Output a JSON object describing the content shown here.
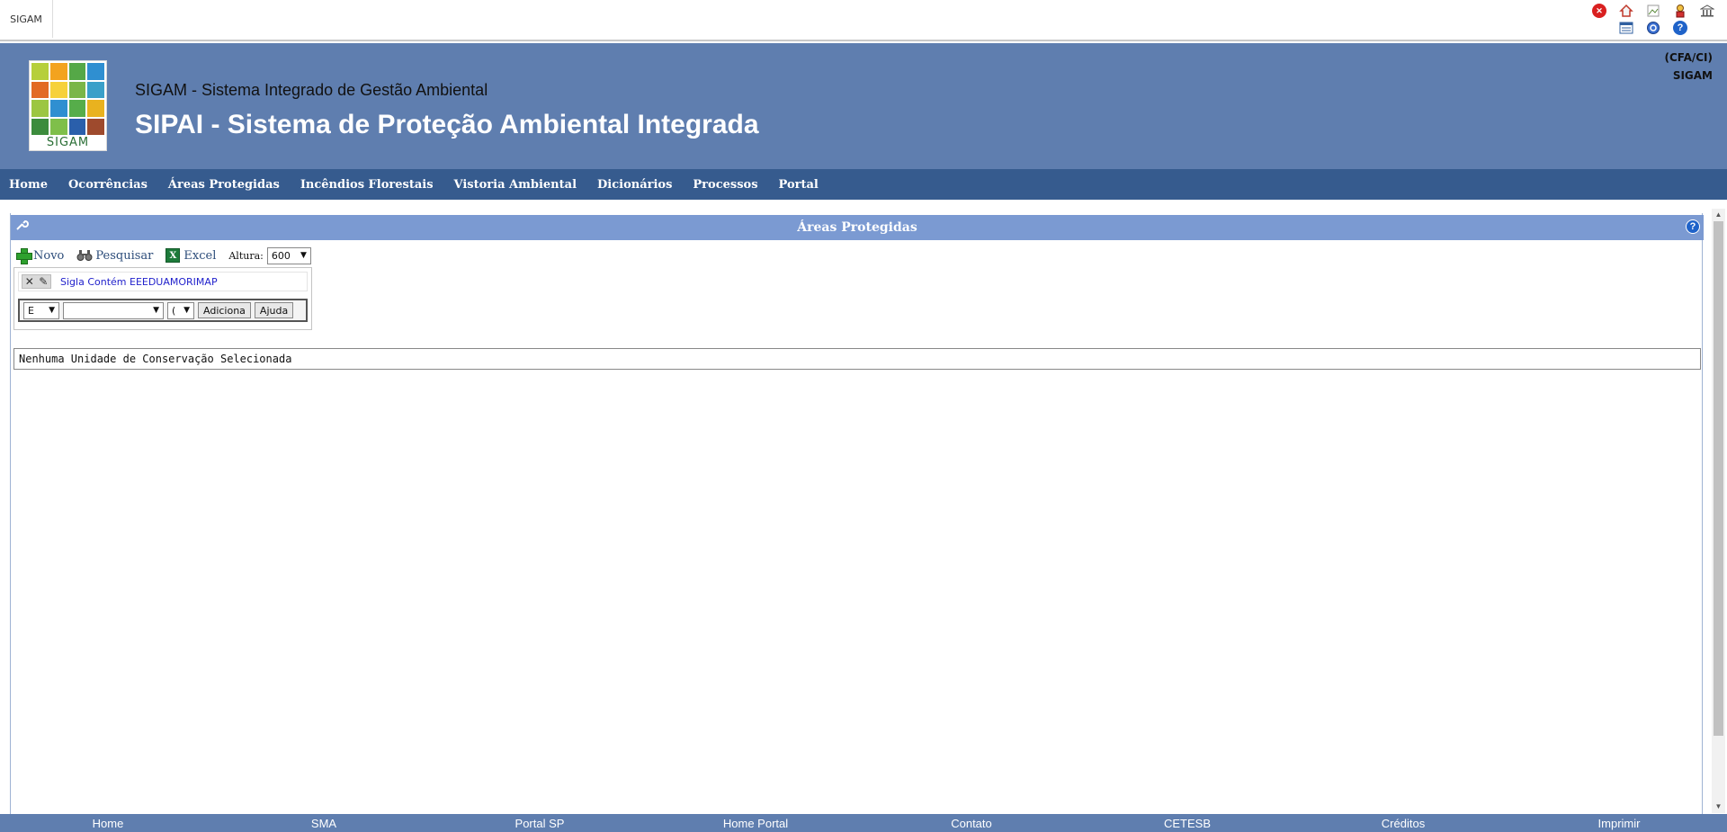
{
  "topbar": {
    "app_tab": "SIGAM",
    "icons": [
      "close-icon",
      "home-icon",
      "broken-image-icon",
      "user-icon",
      "institution-icon",
      "calendar-icon",
      "settings-icon",
      "help-icon"
    ],
    "help_glyph": "?",
    "close_glyph": "✕"
  },
  "header": {
    "logo_text": "SIGAM",
    "subtitle": "SIGAM - Sistema Integrado de Gestão Ambiental",
    "title": "SIPAI - Sistema de Proteção Ambiental Integrada",
    "right_line1": "(CFA/CI)",
    "right_line2": "SIGAM",
    "logo_colors": [
      "#b6cf3b",
      "#f3a31f",
      "#55a847",
      "#2f8fd1",
      "#e26a24",
      "#f6d13a",
      "#7ab648",
      "#3aa0c9",
      "#9cc641",
      "#2f8fd1",
      "#56ad4a",
      "#e9b21f",
      "#3c8c3d",
      "#7fbf4a",
      "#2a5fab",
      "#9e4a2d"
    ]
  },
  "nav": {
    "items": [
      "Home",
      "Ocorrências",
      "Áreas Protegidas",
      "Incêndios Florestais",
      "Vistoria Ambiental",
      "Dicionários",
      "Processos",
      "Portal"
    ]
  },
  "panel": {
    "title": "Áreas Protegidas",
    "help_glyph": "?"
  },
  "toolbar": {
    "novo": "Novo",
    "pesquisar": "Pesquisar",
    "excel": "Excel",
    "excel_glyph": "X",
    "altura_label": "Altura:",
    "altura_value": "600"
  },
  "filter": {
    "applied_text": "Sigla Contém EEEDUAMORIMAP",
    "operator_value": "E",
    "field_value": "",
    "paren_value": "(",
    "add_button": "Adiciona",
    "help_button": "Ajuda"
  },
  "message": "Nenhuma Unidade de Conservação Selecionada",
  "footer": {
    "items": [
      "Home",
      "SMA",
      "Portal SP",
      "Home Portal",
      "Contato",
      "CETESB",
      "Créditos",
      "Imprimir"
    ]
  }
}
